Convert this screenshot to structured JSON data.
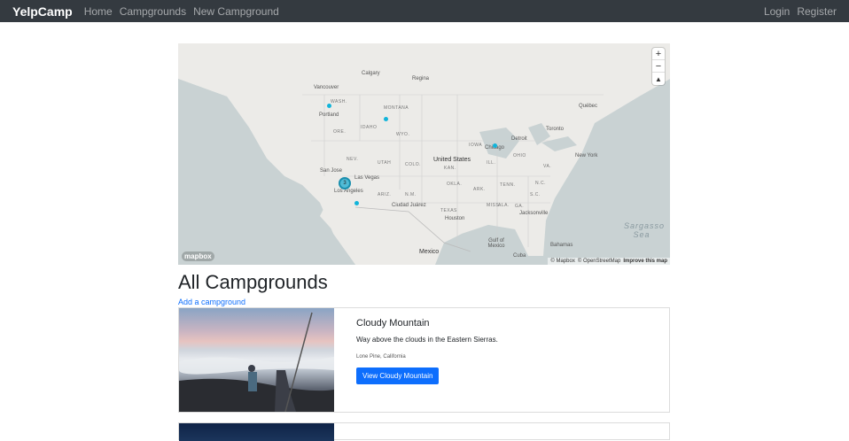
{
  "navbar": {
    "brand": "YelpCamp",
    "links": [
      "Home",
      "Campgrounds",
      "New Campground"
    ],
    "right_links": [
      "Login",
      "Register"
    ]
  },
  "map": {
    "places": {
      "vancouver": "Vancouver",
      "calgary": "Calgary",
      "regina": "Regina",
      "quebec": "Québec",
      "portland": "Portland",
      "toronto": "Toronto",
      "detroit": "Detroit",
      "chicago": "Chicago",
      "newyork": "New York",
      "sanjose": "San Jose",
      "lasvegas": "Las Vegas",
      "losangeles": "Los Angeles",
      "ciudad": "Ciudad Juárez",
      "houston": "Houston",
      "jacksonville": "Jacksonville",
      "mexico": "Mexico",
      "united_states": "United States",
      "bahamas": "Bahamas",
      "cuba": "Cuba",
      "gulf": "Gulf of Mexico",
      "sargasso": "Sargasso Sea"
    },
    "states": [
      "WASH.",
      "MONTANA",
      "ORE.",
      "IDAHO",
      "WYO.",
      "NEV.",
      "UTAH",
      "COLO.",
      "ARIZ.",
      "N.M.",
      "TEXAS",
      "OKLA.",
      "KAN.",
      "IOWA",
      "MISS.",
      "ALA.",
      "TENN.",
      "ARK.",
      "VA.",
      "N.C.",
      "S.C.",
      "GA.",
      "ILL.",
      "OHIO"
    ],
    "cluster_count": "3",
    "mapbox_logo": "mapbox",
    "attribution": [
      "© Mapbox",
      "© OpenStreetMap",
      "Improve this map"
    ],
    "zoom_in": "+",
    "zoom_out": "−",
    "reset": "▲"
  },
  "page_title": "All Campgrounds",
  "add_link": "Add a campground",
  "campgrounds": [
    {
      "title": "Cloudy Mountain",
      "description": "Way above the clouds in the Eastern Sierras.",
      "location": "Lone Pine, California",
      "button": "View Cloudy Mountain"
    }
  ],
  "colors": {
    "navbar": "#343a40",
    "primary": "#0d6efd",
    "cluster": "#11b4da"
  }
}
